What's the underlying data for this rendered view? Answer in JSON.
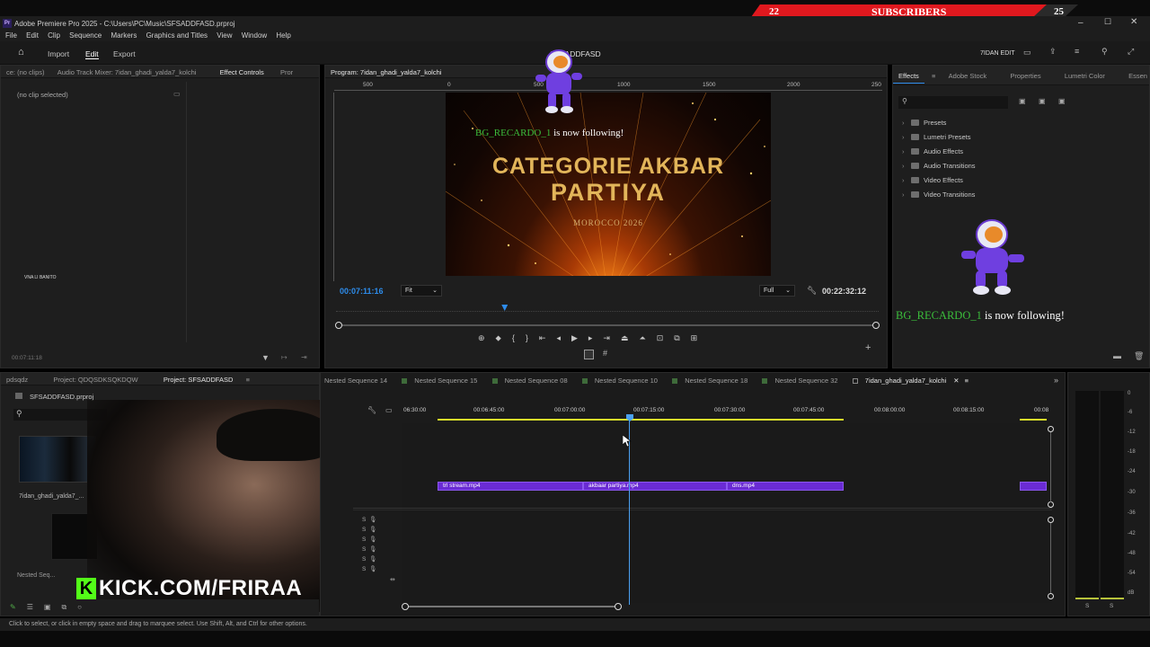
{
  "overlay": {
    "sub_left": "22",
    "sub_label": "SUBSCRIBERS",
    "sub_right": "25",
    "kick_url": "KICK.COM/FRIRAA",
    "follow_top": "BG_RECARDO_1 is now following!",
    "follow_right": "BG_RECARDO_1 is now following!",
    "follow_user": "BG_RECARDO_1",
    "follow_text": "is now following!"
  },
  "window": {
    "app_icon": "Pr",
    "title": "Adobe Premiere Pro 2025 - C:\\Users\\PC\\Music\\SFSADDFASD.prproj"
  },
  "menu": [
    "File",
    "Edit",
    "Clip",
    "Sequence",
    "Markers",
    "Graphics and Titles",
    "View",
    "Window",
    "Help"
  ],
  "workspace": {
    "import": "Import",
    "edit": "Edit",
    "export": "Export",
    "project_name": "SFSADDFASD",
    "user": "7IDAN EDIT"
  },
  "source_panel": {
    "tabs": [
      "ce: (no clips)",
      "Audio Track Mixer: 7idan_ghadi_yalda7_kolchi",
      "Effect Controls",
      "Pror"
    ],
    "no_clip": "(no clip selected)",
    "small_label": "VNA LI BANITO",
    "timecode": "00:07:11:18"
  },
  "program": {
    "title": "Program: 7idan_ghadi_yalda7_kolchi",
    "ruler": [
      "500",
      "0",
      "500",
      "1000",
      "1500",
      "2000",
      "250"
    ],
    "video_title_line1": "CATEGORIE AKBAR",
    "video_title_line2": "PARTIYA",
    "video_subtitle": "MOROCCO 2026",
    "current_time": "00:07:11:16",
    "fit": "Fit",
    "full": "Full",
    "duration": "00:22:32:12",
    "playhead_fraction": 0.31
  },
  "effects": {
    "tabs": [
      "Effects",
      "Adobe Stock",
      "Properties",
      "Lumetri Color",
      "Essen"
    ],
    "items": [
      "Presets",
      "Lumetri Presets",
      "Audio Effects",
      "Audio Transitions",
      "Video Effects",
      "Video Transitions"
    ]
  },
  "project": {
    "tabs": [
      "pdsqdz",
      "Project: QDQSDKSQKDQW",
      "Project: SFSADDFASD"
    ],
    "file": "SFSADDFASD.prproj",
    "bin_item1": "7idan_ghadi_yalda7_...",
    "bin_item2": "Nested Seq..."
  },
  "timeline": {
    "tabs": [
      "Nested Sequence 14",
      "Nested Sequence 15",
      "Nested Sequence 08",
      "Nested Sequence 10",
      "Nested Sequence 18",
      "Nested Sequence 32",
      "7idan_ghadi_yalda7_kolchi"
    ],
    "ruler": [
      "06:30:00",
      "00:06:45:00",
      "00:07:00:00",
      "00:07:15:00",
      "00:07:30:00",
      "00:07:45:00",
      "00:08:00:00",
      "00:08:15:00",
      "00:08"
    ],
    "clips": [
      "trl stream.mp4",
      "akbaar partiya.mp4",
      "dns.mp4"
    ]
  },
  "meter": {
    "scale": [
      "0",
      "-6",
      "-12",
      "-18",
      "-24",
      "-30",
      "-36",
      "-42",
      "-48",
      "-54",
      "dB"
    ],
    "labels": [
      "S",
      "S"
    ]
  },
  "status": {
    "text": "Click to select, or click in empty space and drag to marquee select. Use Shift, Alt, and Ctrl for other options."
  },
  "colors": {
    "accent_blue": "#2d8ceb",
    "clip_purple": "#6a2bd4",
    "sub_red": "#e0181e",
    "follow_green": "#3bbd3b",
    "kick_green": "#53fc18",
    "gold": "#e2b55a"
  }
}
